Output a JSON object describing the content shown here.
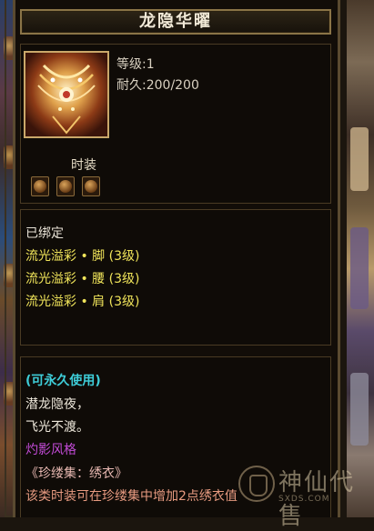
{
  "item": {
    "name": "龙隐华曜",
    "level": "等级:1",
    "durability": "耐久:200/200",
    "category": "时装",
    "slots": 3
  },
  "attributes": {
    "bound": "已绑定",
    "effects": [
      "流光溢彩 • 脚 (3级)",
      "流光溢彩 • 腰 (3级)",
      "流光溢彩 • 肩 (3级)"
    ]
  },
  "description": {
    "permanent": "(可永久使用)",
    "lines": [
      "潜龙隐夜，",
      "飞光不渡。"
    ],
    "style": "灼影风格",
    "collection": "《珍缕集：绣衣》",
    "collection_desc": "该类时装可在珍缕集中增加2点绣衣值"
  },
  "watermark": {
    "text": "神仙代售",
    "url": "SXDS.COM"
  },
  "colors": {
    "title_border": "#8a7447",
    "effect_yellow": "#f0e45a",
    "permanent_cyan": "#3ecdd8",
    "style_purple": "#c24bd6"
  }
}
